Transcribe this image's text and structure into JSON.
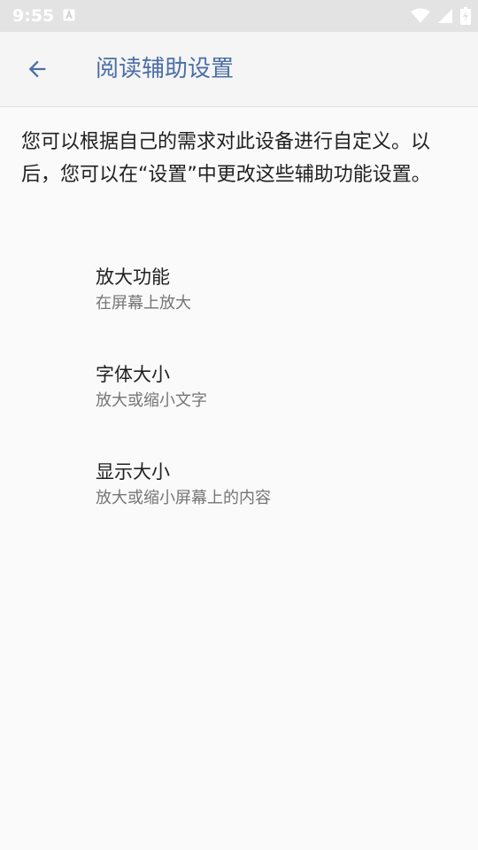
{
  "status_bar": {
    "time": "9:55",
    "icons": [
      "app-notification-icon",
      "wifi-icon",
      "cellular-signal-icon",
      "battery-charging-icon"
    ]
  },
  "app_bar": {
    "back_icon": "arrow-back-icon",
    "title": "阅读辅助设置"
  },
  "description": "您可以根据自己的需求对此设备进行自定义。以后，您可以在“设置”中更改这些辅助功能设置。",
  "options": [
    {
      "title": "放大功能",
      "summary": "在屏幕上放大"
    },
    {
      "title": "字体大小",
      "summary": "放大或缩小文字"
    },
    {
      "title": "显示大小",
      "summary": "放大或缩小屏幕上的内容"
    }
  ],
  "colors": {
    "accent": "#4a6fa5",
    "status_bar": "#e3e3e3",
    "background": "#fafafa",
    "primary_text": "#212121",
    "secondary_text": "#757575"
  }
}
